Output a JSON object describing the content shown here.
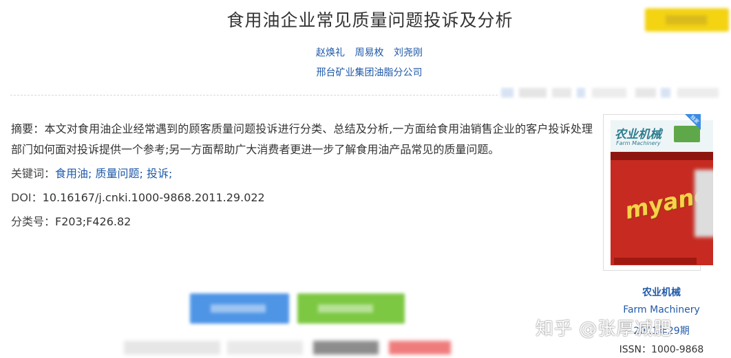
{
  "article": {
    "title": "食用油企业常见质量问题投诉及分析",
    "authors": [
      "赵焕礼",
      "周易枚",
      "刘尧刚"
    ],
    "organization": "邢台矿业集团油脂分公司"
  },
  "details": {
    "abstract_label": "摘要：",
    "abstract_text": "本文对食用油企业经常遇到的顾客质量问题投诉进行分类、总结及分析,一方面给食用油销售企业的客户投诉处理部门如何面对投诉提供一个参考;另一方面帮助广大消费者更进一步了解食用油产品常见的质量问题。",
    "keywords_label": "关键词：",
    "keywords": [
      "食用油;",
      "质量问题;",
      "投诉;"
    ],
    "doi_label": "DOI：",
    "doi_value": "10.16167/j.cnki.1000-9868.2011.29.022",
    "class_label": "分类号：",
    "class_value": "F203;F426.82"
  },
  "journal": {
    "cover_title": "农业机械",
    "cover_subtitle": "Farm Machinery",
    "cover_text": "myano",
    "badge": "独家",
    "name_cn": "农业机械",
    "name_en": "Farm Machinery",
    "issue": "2011年29期",
    "issn": "ISSN：1000-9868"
  },
  "watermark": "知乎 @张厚减肥",
  "colors": {
    "link": "#1f59a8",
    "text": "#333333",
    "action_yellow": "#f3d312",
    "action_blue": "#4f95e6",
    "action_green": "#7dc843"
  }
}
